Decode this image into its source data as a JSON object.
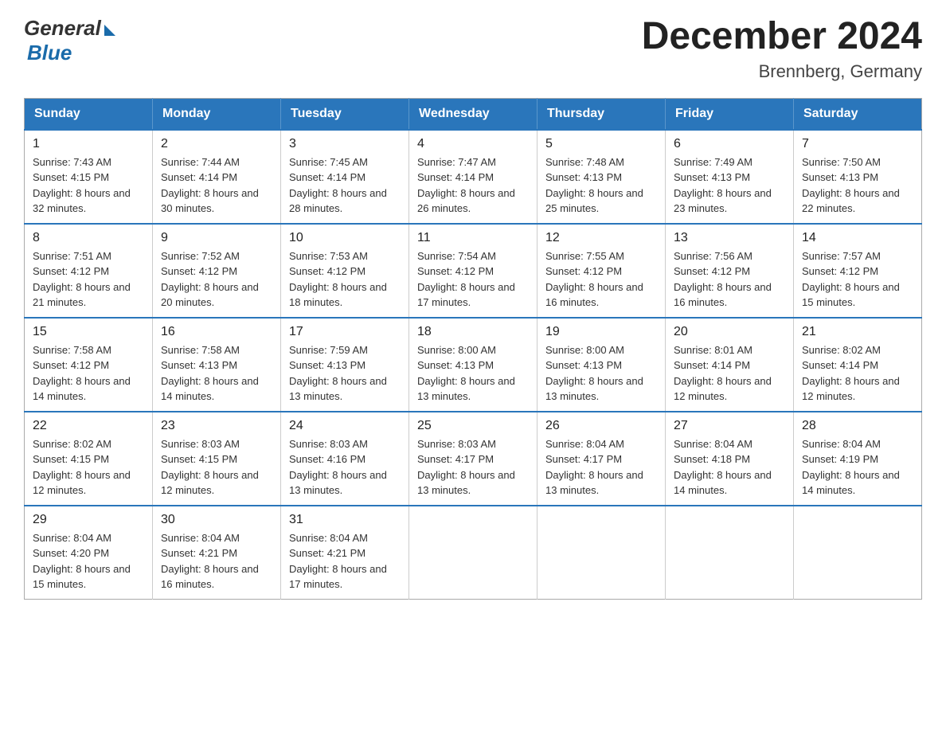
{
  "logo": {
    "general": "General",
    "blue": "Blue"
  },
  "title": "December 2024",
  "subtitle": "Brennberg, Germany",
  "weekdays": [
    "Sunday",
    "Monday",
    "Tuesday",
    "Wednesday",
    "Thursday",
    "Friday",
    "Saturday"
  ],
  "weeks": [
    [
      {
        "day": "1",
        "sunrise": "7:43 AM",
        "sunset": "4:15 PM",
        "daylight": "8 hours and 32 minutes."
      },
      {
        "day": "2",
        "sunrise": "7:44 AM",
        "sunset": "4:14 PM",
        "daylight": "8 hours and 30 minutes."
      },
      {
        "day": "3",
        "sunrise": "7:45 AM",
        "sunset": "4:14 PM",
        "daylight": "8 hours and 28 minutes."
      },
      {
        "day": "4",
        "sunrise": "7:47 AM",
        "sunset": "4:14 PM",
        "daylight": "8 hours and 26 minutes."
      },
      {
        "day": "5",
        "sunrise": "7:48 AM",
        "sunset": "4:13 PM",
        "daylight": "8 hours and 25 minutes."
      },
      {
        "day": "6",
        "sunrise": "7:49 AM",
        "sunset": "4:13 PM",
        "daylight": "8 hours and 23 minutes."
      },
      {
        "day": "7",
        "sunrise": "7:50 AM",
        "sunset": "4:13 PM",
        "daylight": "8 hours and 22 minutes."
      }
    ],
    [
      {
        "day": "8",
        "sunrise": "7:51 AM",
        "sunset": "4:12 PM",
        "daylight": "8 hours and 21 minutes."
      },
      {
        "day": "9",
        "sunrise": "7:52 AM",
        "sunset": "4:12 PM",
        "daylight": "8 hours and 20 minutes."
      },
      {
        "day": "10",
        "sunrise": "7:53 AM",
        "sunset": "4:12 PM",
        "daylight": "8 hours and 18 minutes."
      },
      {
        "day": "11",
        "sunrise": "7:54 AM",
        "sunset": "4:12 PM",
        "daylight": "8 hours and 17 minutes."
      },
      {
        "day": "12",
        "sunrise": "7:55 AM",
        "sunset": "4:12 PM",
        "daylight": "8 hours and 16 minutes."
      },
      {
        "day": "13",
        "sunrise": "7:56 AM",
        "sunset": "4:12 PM",
        "daylight": "8 hours and 16 minutes."
      },
      {
        "day": "14",
        "sunrise": "7:57 AM",
        "sunset": "4:12 PM",
        "daylight": "8 hours and 15 minutes."
      }
    ],
    [
      {
        "day": "15",
        "sunrise": "7:58 AM",
        "sunset": "4:12 PM",
        "daylight": "8 hours and 14 minutes."
      },
      {
        "day": "16",
        "sunrise": "7:58 AM",
        "sunset": "4:13 PM",
        "daylight": "8 hours and 14 minutes."
      },
      {
        "day": "17",
        "sunrise": "7:59 AM",
        "sunset": "4:13 PM",
        "daylight": "8 hours and 13 minutes."
      },
      {
        "day": "18",
        "sunrise": "8:00 AM",
        "sunset": "4:13 PM",
        "daylight": "8 hours and 13 minutes."
      },
      {
        "day": "19",
        "sunrise": "8:00 AM",
        "sunset": "4:13 PM",
        "daylight": "8 hours and 13 minutes."
      },
      {
        "day": "20",
        "sunrise": "8:01 AM",
        "sunset": "4:14 PM",
        "daylight": "8 hours and 12 minutes."
      },
      {
        "day": "21",
        "sunrise": "8:02 AM",
        "sunset": "4:14 PM",
        "daylight": "8 hours and 12 minutes."
      }
    ],
    [
      {
        "day": "22",
        "sunrise": "8:02 AM",
        "sunset": "4:15 PM",
        "daylight": "8 hours and 12 minutes."
      },
      {
        "day": "23",
        "sunrise": "8:03 AM",
        "sunset": "4:15 PM",
        "daylight": "8 hours and 12 minutes."
      },
      {
        "day": "24",
        "sunrise": "8:03 AM",
        "sunset": "4:16 PM",
        "daylight": "8 hours and 13 minutes."
      },
      {
        "day": "25",
        "sunrise": "8:03 AM",
        "sunset": "4:17 PM",
        "daylight": "8 hours and 13 minutes."
      },
      {
        "day": "26",
        "sunrise": "8:04 AM",
        "sunset": "4:17 PM",
        "daylight": "8 hours and 13 minutes."
      },
      {
        "day": "27",
        "sunrise": "8:04 AM",
        "sunset": "4:18 PM",
        "daylight": "8 hours and 14 minutes."
      },
      {
        "day": "28",
        "sunrise": "8:04 AM",
        "sunset": "4:19 PM",
        "daylight": "8 hours and 14 minutes."
      }
    ],
    [
      {
        "day": "29",
        "sunrise": "8:04 AM",
        "sunset": "4:20 PM",
        "daylight": "8 hours and 15 minutes."
      },
      {
        "day": "30",
        "sunrise": "8:04 AM",
        "sunset": "4:21 PM",
        "daylight": "8 hours and 16 minutes."
      },
      {
        "day": "31",
        "sunrise": "8:04 AM",
        "sunset": "4:21 PM",
        "daylight": "8 hours and 17 minutes."
      },
      null,
      null,
      null,
      null
    ]
  ]
}
